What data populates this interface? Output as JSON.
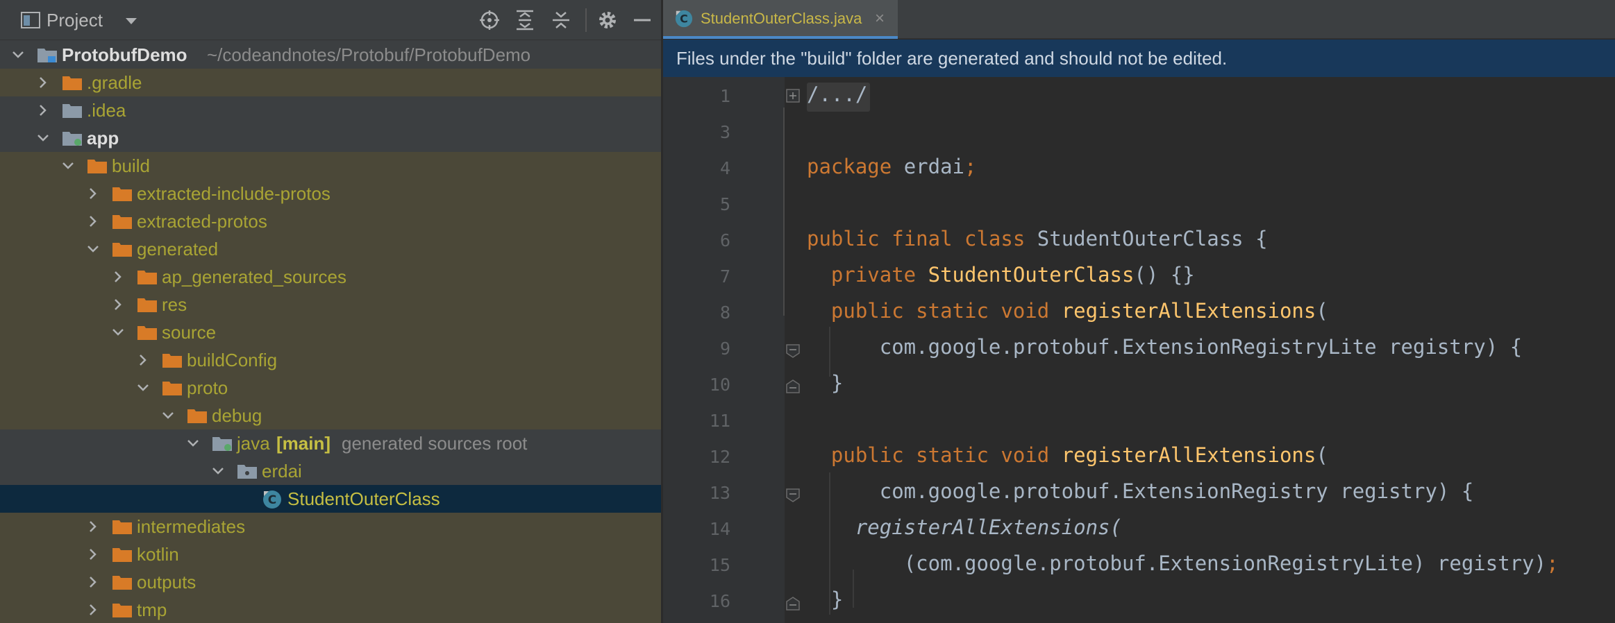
{
  "project_panel": {
    "title": "Project",
    "toolbar": [
      "locate-icon",
      "expand-all-icon",
      "collapse-all-icon",
      "gear-icon",
      "minimize-icon"
    ],
    "root": {
      "name": "ProtobufDemo",
      "path": "~/codeandnotes/Protobuf/ProtobufDemo"
    },
    "tree": [
      {
        "label": ".gradle"
      },
      {
        "label": ".idea"
      },
      {
        "label": "app"
      },
      {
        "label": "build"
      },
      {
        "label": "extracted-include-protos"
      },
      {
        "label": "extracted-protos"
      },
      {
        "label": "generated"
      },
      {
        "label": "ap_generated_sources"
      },
      {
        "label": "res"
      },
      {
        "label": "source"
      },
      {
        "label": "buildConfig"
      },
      {
        "label": "proto"
      },
      {
        "label": "debug"
      },
      {
        "label": "java",
        "module": "[main]",
        "hint": "generated sources root"
      },
      {
        "label": "erdai"
      },
      {
        "label": "StudentOuterClass"
      },
      {
        "label": "intermediates"
      },
      {
        "label": "kotlin"
      },
      {
        "label": "outputs"
      },
      {
        "label": "tmp"
      }
    ]
  },
  "editor": {
    "tab": {
      "label": "StudentOuterClass.java",
      "close": "×"
    },
    "banner": "Files under the \"build\" folder are generated and should not be edited.",
    "lines": [
      {
        "n": "1",
        "code": "/.../"
      },
      {
        "n": "3",
        "code": ""
      },
      {
        "n": "4",
        "code": "package erdai;"
      },
      {
        "n": "5",
        "code": ""
      },
      {
        "n": "6",
        "code": "public final class StudentOuterClass {"
      },
      {
        "n": "7",
        "code": "  private StudentOuterClass() {}"
      },
      {
        "n": "8",
        "code": "  public static void registerAllExtensions("
      },
      {
        "n": "9",
        "code": "      com.google.protobuf.ExtensionRegistryLite registry) {"
      },
      {
        "n": "10",
        "code": "  }"
      },
      {
        "n": "11",
        "code": ""
      },
      {
        "n": "12",
        "code": "  public static void registerAllExtensions("
      },
      {
        "n": "13",
        "code": "      com.google.protobuf.ExtensionRegistry registry) {"
      },
      {
        "n": "14",
        "code": "    registerAllExtensions("
      },
      {
        "n": "15",
        "code": "        (com.google.protobuf.ExtensionRegistryLite) registry);"
      },
      {
        "n": "16",
        "code": "  }"
      }
    ]
  },
  "colors": {
    "keyword": "#cc7832",
    "method": "#ffc66d",
    "text": "#a9b7c6",
    "folder": "#d87b27",
    "selection": "#0d293e",
    "banner": "#18385a"
  }
}
